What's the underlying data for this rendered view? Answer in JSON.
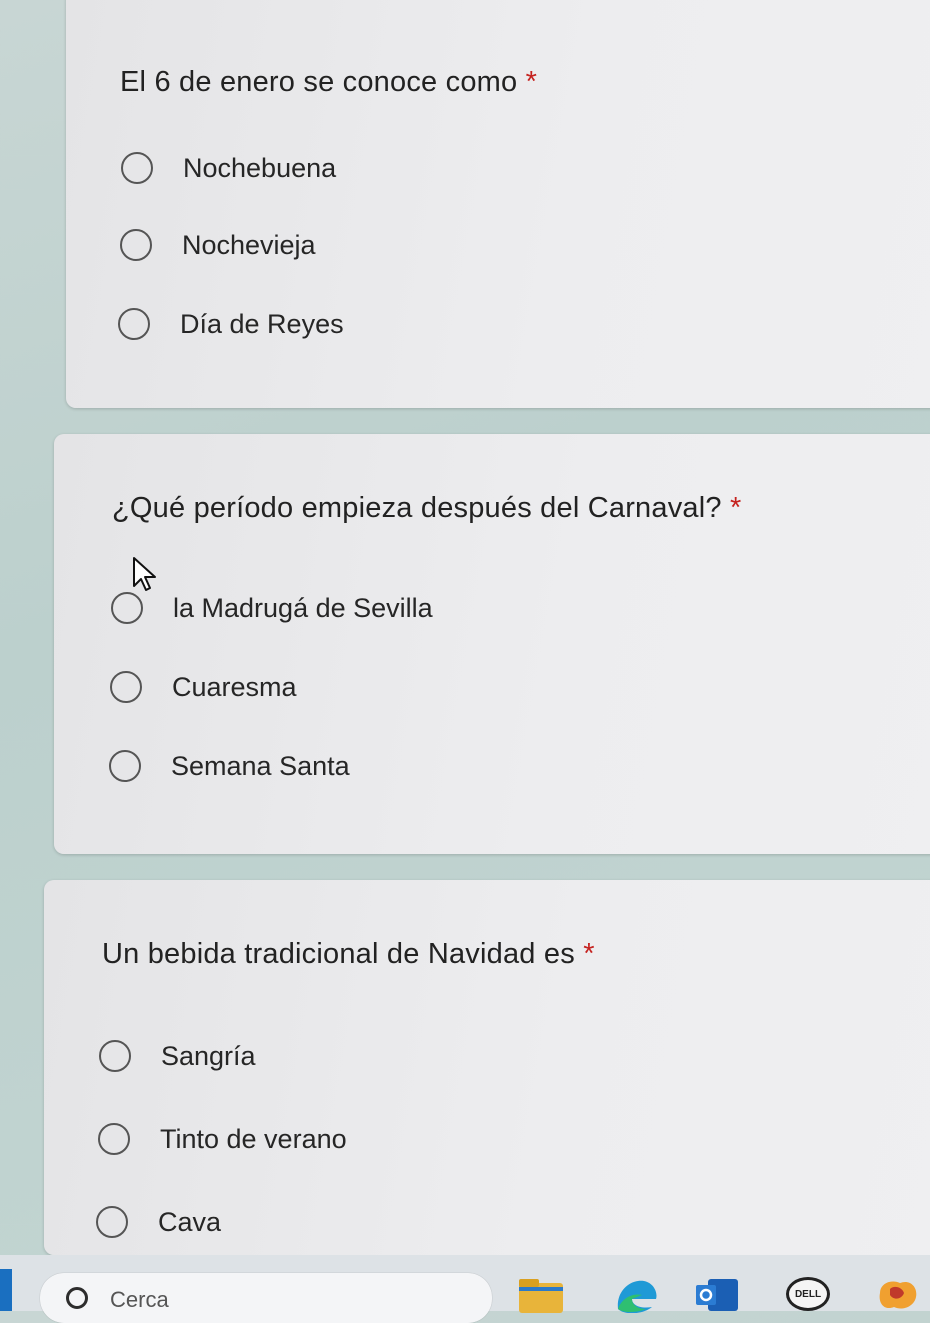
{
  "questions": [
    {
      "title": "El 6 de enero se conoce como",
      "required_mark": "*",
      "options": [
        "Nochebuena",
        "Nochevieja",
        "Día de Reyes"
      ]
    },
    {
      "title": "¿Qué período empieza después del Carnaval?",
      "required_mark": "*",
      "options": [
        "la Madrugá de Sevilla",
        "Cuaresma",
        "Semana Santa"
      ]
    },
    {
      "title": "Un bebida tradicional de Navidad es",
      "required_mark": "*",
      "options": [
        "Sangría",
        "Tinto de verano",
        "Cava"
      ]
    }
  ],
  "taskbar": {
    "search_placeholder": "Cerca",
    "pinned_icons": [
      "file-explorer-icon",
      "edge-browser-icon",
      "office-icon",
      "dell-icon",
      "app-icon"
    ],
    "dell_label": "DELL"
  },
  "colors": {
    "required": "#c5221f",
    "card_background": "#ececee",
    "page_background": "#c4d6d3"
  }
}
